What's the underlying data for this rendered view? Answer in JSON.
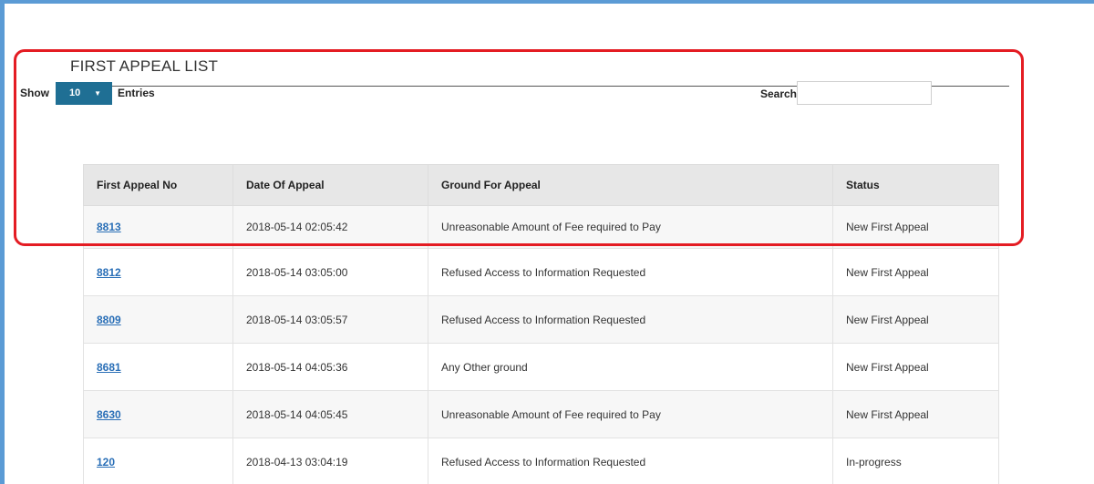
{
  "panel": {
    "title": "FIRST APPEAL LIST"
  },
  "controls": {
    "show_label": "Show",
    "length_value": "10",
    "entries_label": "Entries",
    "search_label": "Search:",
    "search_value": ""
  },
  "table": {
    "headers": [
      "First Appeal No",
      "Date Of Appeal",
      "Ground For Appeal",
      "Status"
    ],
    "rows": [
      {
        "no": "8813",
        "date": "2018-05-14 02:05:42",
        "ground": "Unreasonable Amount of Fee required to Pay",
        "status": "New First Appeal"
      },
      {
        "no": "8812",
        "date": "2018-05-14 03:05:00",
        "ground": "Refused Access to Information Requested",
        "status": "New First Appeal"
      },
      {
        "no": "8809",
        "date": "2018-05-14 03:05:57",
        "ground": "Refused Access to Information Requested",
        "status": "New First Appeal"
      },
      {
        "no": "8681",
        "date": "2018-05-14 04:05:36",
        "ground": "Any Other ground",
        "status": "New First Appeal"
      },
      {
        "no": "8630",
        "date": "2018-05-14 04:05:45",
        "ground": "Unreasonable Amount of Fee required to Pay",
        "status": "New First Appeal"
      },
      {
        "no": "120",
        "date": "2018-04-13 03:04:19",
        "ground": "Refused Access to Information Requested",
        "status": "In-progress"
      }
    ]
  },
  "colors": {
    "window_border": "#5b9bd5",
    "highlight": "#e41c23",
    "select_bg": "#1f6f94",
    "link": "#2a6fb7",
    "header_bg": "#e7e7e7"
  },
  "icons": {
    "length_caret": "caret-down-icon"
  }
}
